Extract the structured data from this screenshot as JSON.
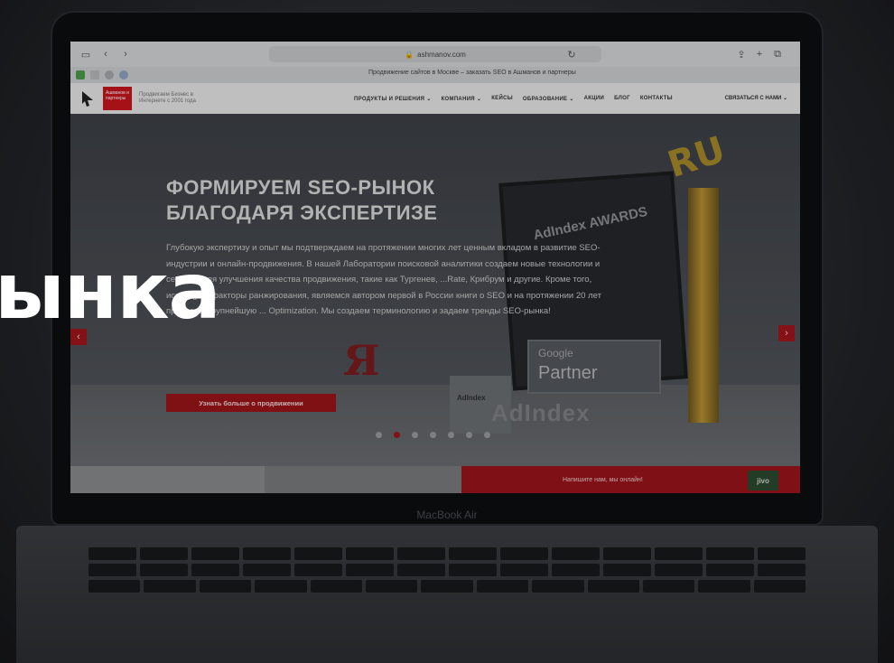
{
  "browser": {
    "url": "ashmanov.com",
    "tab_title": "Продвижение сайтов в Москве – заказать SEO в Ашманов и партнеры"
  },
  "site": {
    "logo_text": "Ашманов и партнеры",
    "tagline": "Продвигаем Бизнес в Интернете с 2001 года",
    "nav": [
      "ПРОДУКТЫ И РЕШЕНИЯ ⌄",
      "КОМПАНИЯ ⌄",
      "КЕЙСЫ",
      "ОБРАЗОВАНИЕ ⌄",
      "АКЦИИ",
      "БЛОГ",
      "КОНТАКТЫ"
    ],
    "contact_nav": "СВЯЗАТЬСЯ С НАМИ ⌄"
  },
  "hero": {
    "title_line1": "ФОРМИРУЕМ SEO-РЫНОК",
    "title_line2": "БЛАГОДАРЯ ЭКСПЕРТИЗЕ",
    "body": "Глубокую экспертизу и опыт мы подтверждаем на протяжении многих лет ценным вкладом в развитие SEO-индустрии и онлайн-продвижения. В нашей Лаборатории поисковой аналитики создаем новые технологии и сервисы для улучшения качества продвижения, такие как Тургенев, ...Rate, Крибрум и другие. Кроме того, исследуем факторы ранжирования, являемся автором первой в России книги о SEO и на протяжении 20 лет проводим крупнейшую ... Optimization. Мы создаем терминологию и задаем тренды SEO-рынка!",
    "cta": "Узнать больше о продвижении",
    "prev_arrow": "‹",
    "next_arrow": "›",
    "slide_count": 7,
    "active_slide": 2
  },
  "awards": {
    "plaque": "AdIndex AWARDS",
    "ru": "RU",
    "google_line1": "Google",
    "google_line2": "Partner",
    "adindex": "AdIndex",
    "ya": "Я",
    "small_card": "AdIndex"
  },
  "chat": {
    "label": "Напишите нам, мы онлайн!",
    "widget": "jivo"
  },
  "laptop": {
    "brand": "MacBook Air"
  },
  "overlay": {
    "word": "ынка"
  }
}
